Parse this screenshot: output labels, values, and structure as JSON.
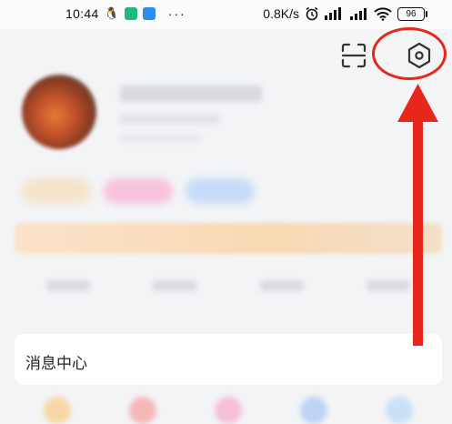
{
  "status_bar": {
    "time": "10:44",
    "more": "···",
    "network_speed": "0.8K/s",
    "battery": "96"
  },
  "header": {
    "scan_icon": "scan-icon",
    "settings_icon": "settings-icon"
  },
  "menu": {
    "message_center": "消息中心"
  },
  "colors": {
    "highlight": "#e8271c",
    "background": "#f3f4f6"
  }
}
